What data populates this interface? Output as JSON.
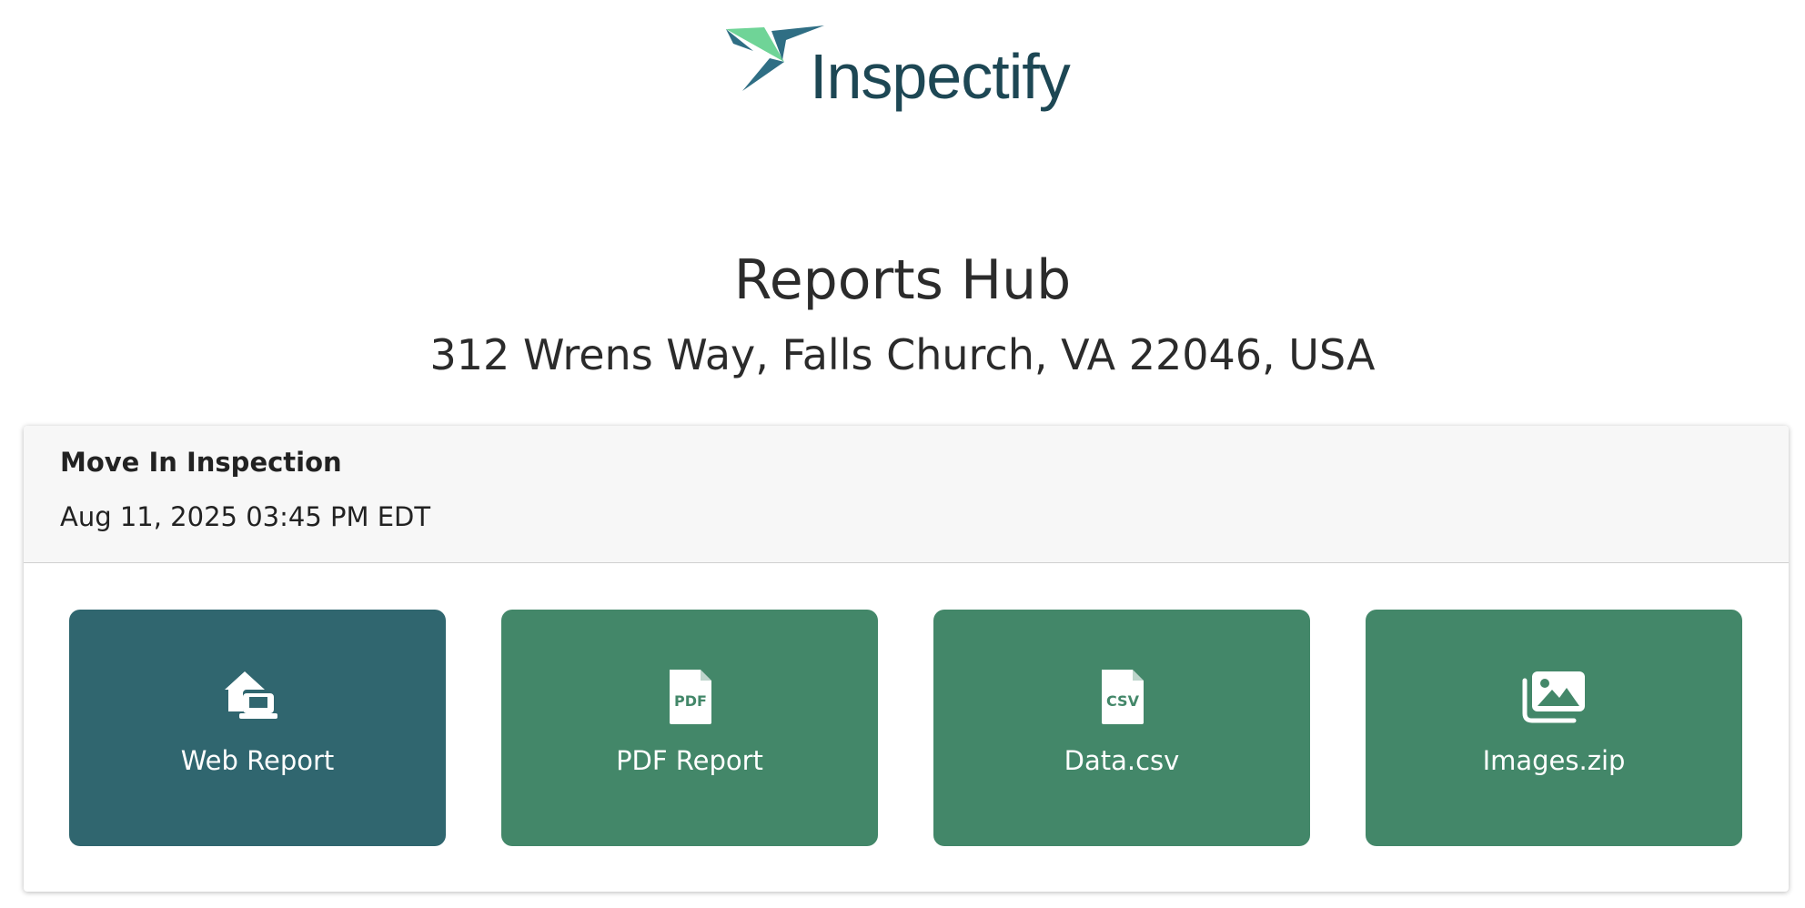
{
  "brand": {
    "name": "Inspectify",
    "logo_icon": "hummingbird-icon",
    "text_color": "#1d4754",
    "bird_colors": [
      "#6fd497",
      "#2f6e84"
    ]
  },
  "page": {
    "title": "Reports Hub",
    "address": "312 Wrens Way, Falls Church, VA 22046, USA"
  },
  "inspection": {
    "name": "Move In Inspection",
    "datetime": "Aug 11, 2025 03:45 PM EDT"
  },
  "actions": [
    {
      "label": "Web Report",
      "icon": "home-laptop-icon",
      "icon_text": "",
      "color": "#30666f"
    },
    {
      "label": "PDF Report",
      "icon": "pdf-file-icon",
      "icon_text": "PDF",
      "color": "#438769"
    },
    {
      "label": "Data.csv",
      "icon": "csv-file-icon",
      "icon_text": "CSV",
      "color": "#438769"
    },
    {
      "label": "Images.zip",
      "icon": "images-icon",
      "icon_text": "",
      "color": "#438769"
    }
  ]
}
